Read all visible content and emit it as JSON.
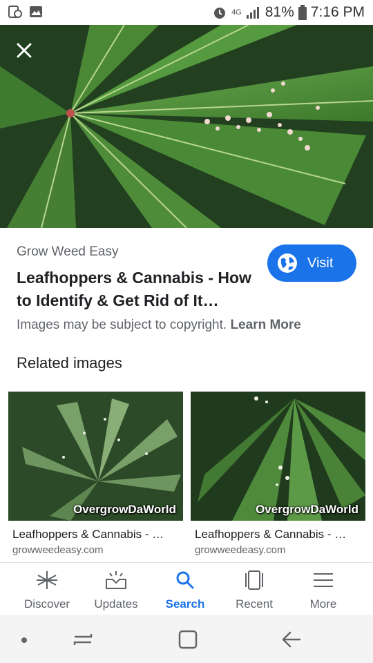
{
  "status_bar": {
    "battery": "81%",
    "time": "7:16 PM",
    "network": "4G"
  },
  "result": {
    "source": "Grow Weed Easy",
    "title": "Leafhoppers & Cannabis - How to Identify & Get Rid of It…",
    "visit_label": "Visit",
    "copyright_text": "Images may be subject to copyright.",
    "learn_more": "Learn More"
  },
  "related": {
    "heading": "Related images",
    "items": [
      {
        "title": "Leafhoppers & Cannabis - …",
        "domain": "growweedeasy.com",
        "watermark": "OvergrowDaWorld"
      },
      {
        "title": "Leafhoppers & Cannabis - …",
        "domain": "growweedeasy.com",
        "watermark": "OvergrowDaWorld"
      }
    ]
  },
  "bottom_nav": {
    "items": [
      {
        "label": "Discover",
        "icon": "asterisk-icon"
      },
      {
        "label": "Updates",
        "icon": "updates-tray-icon"
      },
      {
        "label": "Search",
        "icon": "search-icon"
      },
      {
        "label": "Recent",
        "icon": "recent-cards-icon"
      },
      {
        "label": "More",
        "icon": "menu-lines-icon"
      }
    ],
    "active": "Search"
  },
  "colors": {
    "accent": "#1a73e8",
    "text_primary": "#202124",
    "text_secondary": "#5f6368"
  }
}
